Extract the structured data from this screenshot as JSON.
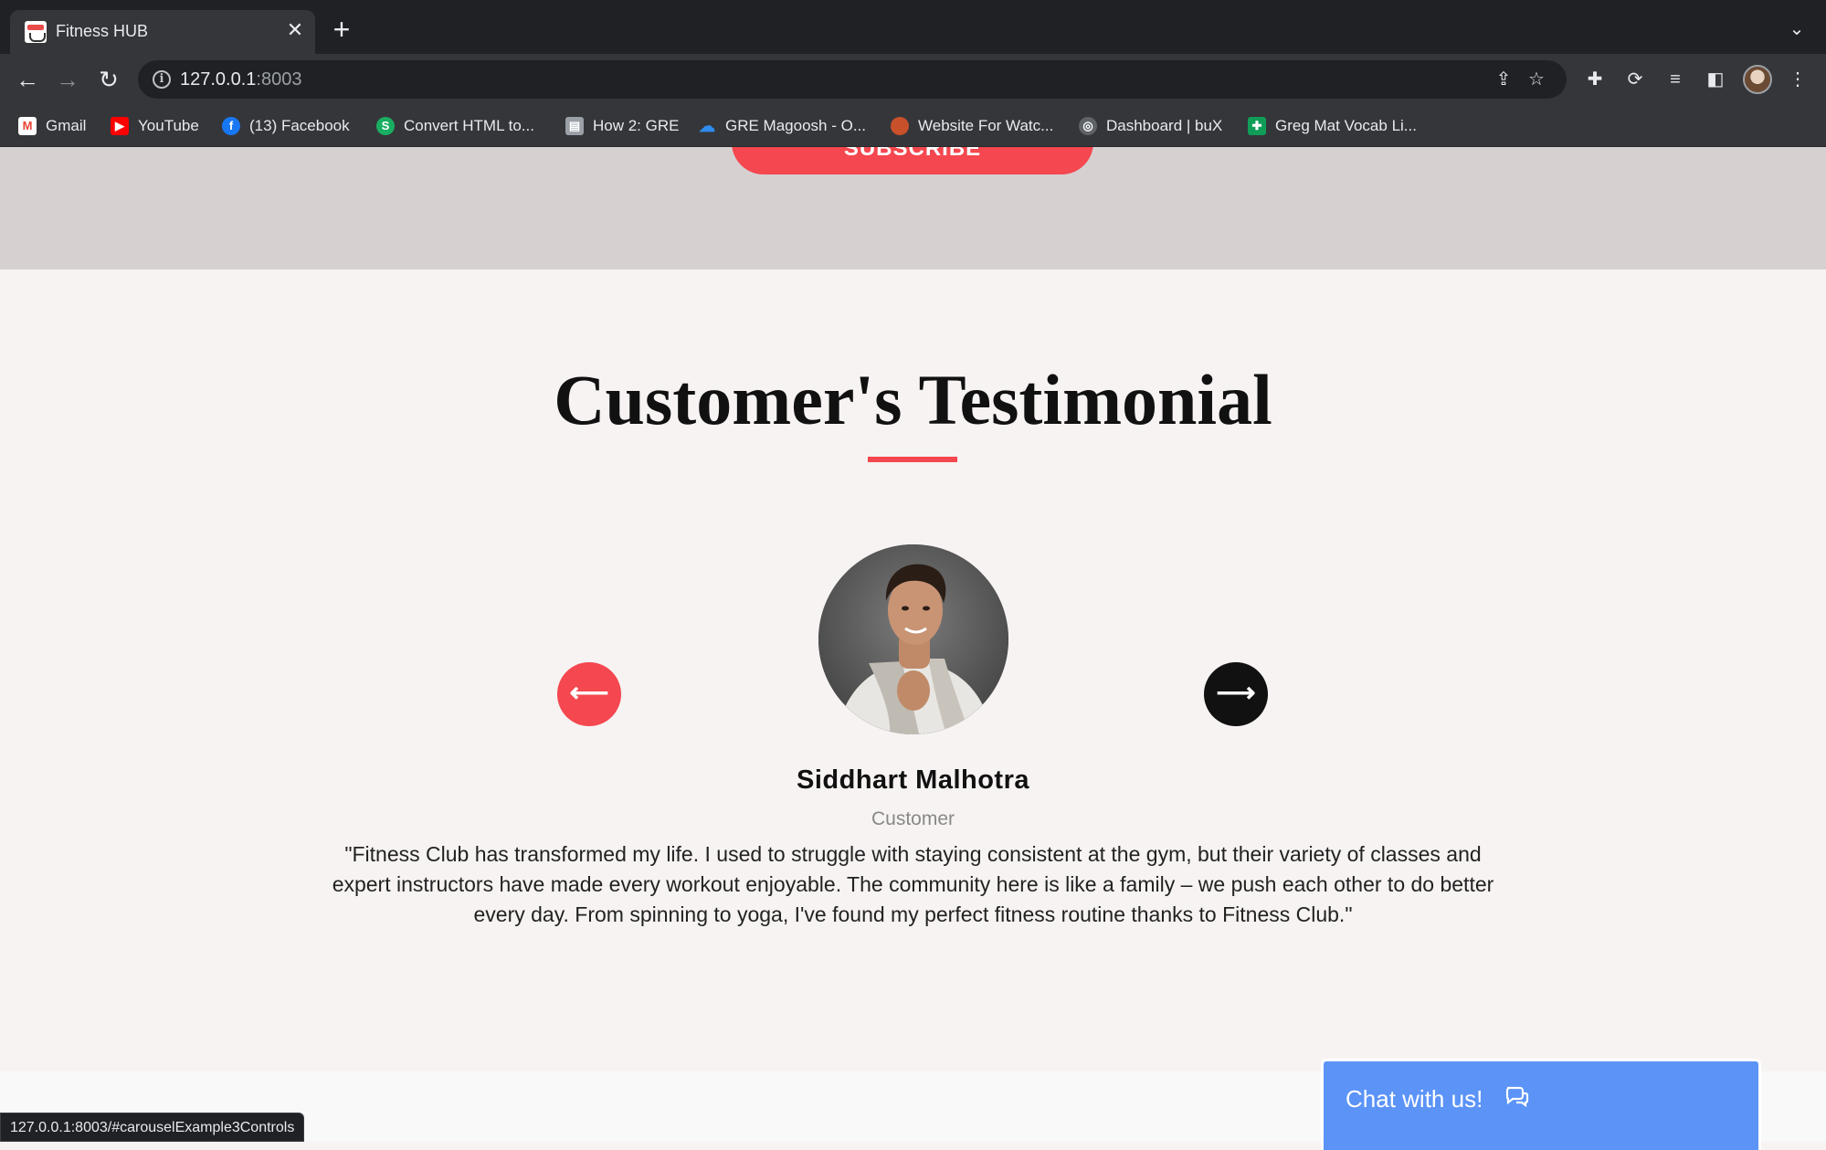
{
  "browser": {
    "tab_title": "Fitness HUB",
    "tab_close": "✕",
    "new_tab": "+",
    "url_host": "127.0.0.1",
    "url_port": ":8003",
    "status_url": "127.0.0.1:8003/#carouselExample3Controls",
    "bookmarks": [
      {
        "label": "Gmail",
        "icon": "gmail-icon"
      },
      {
        "label": "YouTube",
        "icon": "youtube-icon"
      },
      {
        "label": "(13) Facebook",
        "icon": "facebook-icon"
      },
      {
        "label": "Convert HTML to...",
        "icon": "convert-icon"
      },
      {
        "label": "How 2: GRE",
        "icon": "document-icon"
      },
      {
        "label": "GRE Magoosh - O...",
        "icon": "onedrive-icon"
      },
      {
        "label": "Website For Watc...",
        "icon": "website-icon"
      },
      {
        "label": "Dashboard | buX",
        "icon": "dashboard-icon"
      },
      {
        "label": "Greg Mat Vocab Li...",
        "icon": "sheets-icon"
      }
    ]
  },
  "newsletter": {
    "subscribe_label": "SUBSCRIBE"
  },
  "testimonial": {
    "title": "Customer's Testimonial",
    "name": "Siddhart Malhotra",
    "role": "Customer",
    "quote": "\"Fitness Club has transformed my life. I used to struggle with staying consistent at the gym, but their variety of classes and expert instructors have made every workout enjoyable. The community here is like a family – we push each other to do better every day. From spinning to yoga, I've found my perfect fitness routine thanks to Fitness Club.\"",
    "prev_symbol": "⟵",
    "next_symbol": "⟶"
  },
  "chat": {
    "label": "Chat with us!"
  },
  "colors": {
    "accent": "#f4474f",
    "chat_blue": "#5b93f7",
    "dark_button": "#111111"
  }
}
